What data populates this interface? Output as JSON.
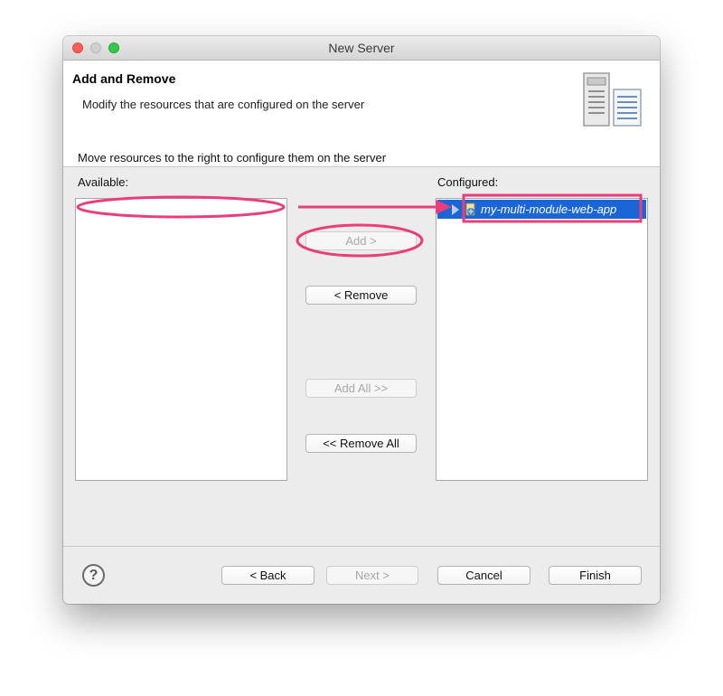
{
  "window": {
    "title": "New Server"
  },
  "header": {
    "title": "Add and Remove",
    "description": "Modify the resources that are configured on the server",
    "icon": "server-icon"
  },
  "instructions": "Move resources to the right to configure them on the server",
  "available": {
    "label": "Available:",
    "items": []
  },
  "configured": {
    "label": "Configured:",
    "items": [
      {
        "label": "my-multi-module-web-app",
        "icon": "module-icon",
        "selected": true
      }
    ]
  },
  "buttons": {
    "add": "Add >",
    "remove": "< Remove",
    "add_all": "Add All >>",
    "remove_all": "<< Remove All"
  },
  "footer": {
    "help": "?",
    "back": "< Back",
    "next": "Next >",
    "cancel": "Cancel",
    "finish": "Finish"
  },
  "colors": {
    "selection": "#1a66d6",
    "annotation": "#ec3d7a"
  }
}
